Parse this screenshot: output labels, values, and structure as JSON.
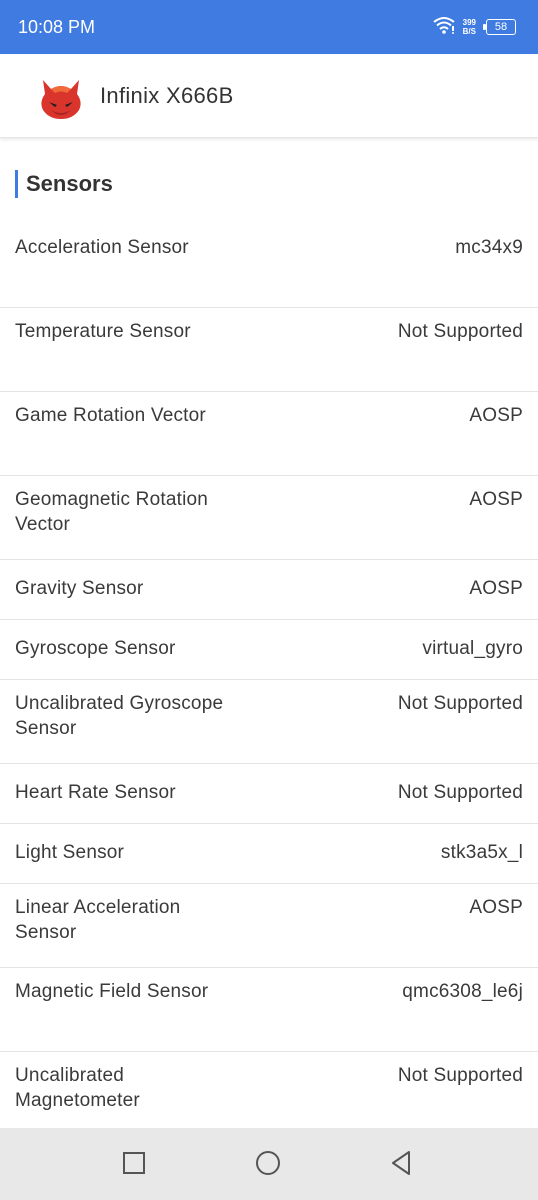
{
  "status_bar": {
    "time": "10:08 PM",
    "speed_value": "399",
    "speed_unit": "B/S",
    "battery": "58"
  },
  "app_bar": {
    "title": "Infinix X666B"
  },
  "section": {
    "title": "Sensors"
  },
  "sensors": [
    {
      "label": "Acceleration Sensor",
      "value": "mc34x9"
    },
    {
      "label": "Temperature Sensor",
      "value": "Not Supported"
    },
    {
      "label": "Game Rotation Vector",
      "value": "AOSP"
    },
    {
      "label": "Geomagnetic Rotation Vector",
      "value": "AOSP"
    },
    {
      "label": "Gravity Sensor",
      "value": "AOSP"
    },
    {
      "label": "Gyroscope Sensor",
      "value": "virtual_gyro"
    },
    {
      "label": "Uncalibrated Gyroscope Sensor",
      "value": "Not Supported"
    },
    {
      "label": "Heart Rate Sensor",
      "value": "Not Supported"
    },
    {
      "label": "Light Sensor",
      "value": "stk3a5x_l"
    },
    {
      "label": "Linear Acceleration Sensor",
      "value": "AOSP"
    },
    {
      "label": "Magnetic Field Sensor",
      "value": "qmc6308_le6j"
    },
    {
      "label": "Uncalibrated Magnetometer",
      "value": "Not Supported"
    }
  ],
  "colors": {
    "accent": "#3f7be0",
    "logo_red": "#d9352c"
  },
  "icons": {
    "wifi": "wifi-icon",
    "battery": "battery-icon",
    "logo": "antutu-logo-icon",
    "recents": "square-icon",
    "home": "circle-icon",
    "back": "triangle-back-icon"
  }
}
